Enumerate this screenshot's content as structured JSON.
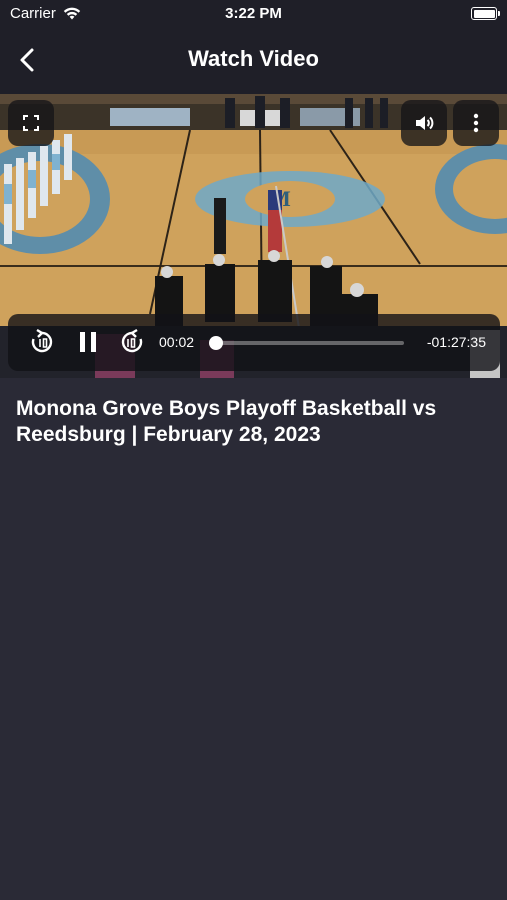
{
  "status_bar": {
    "carrier": "Carrier",
    "time": "3:22 PM",
    "battery_level": 1.0
  },
  "nav": {
    "title": "Watch Video",
    "back_icon": "chevron-left-icon"
  },
  "video": {
    "elapsed": "00:02",
    "remaining": "-01:27:35",
    "progress": 0.0,
    "state": "playing",
    "icons": {
      "fullscreen": "fullscreen-icon",
      "volume": "volume-icon",
      "more": "more-vertical-icon",
      "rewind": "rewind-icon",
      "pause": "pause-icon",
      "forward": "forward-icon"
    }
  },
  "content": {
    "title": "Monona Grove Boys Playoff Basketball vs Reedsburg | February 28, 2023"
  },
  "colors": {
    "background": "#2a2a36",
    "bar": "#1f1f28",
    "court": "#c89a55",
    "accent": "#6ea9c8"
  }
}
